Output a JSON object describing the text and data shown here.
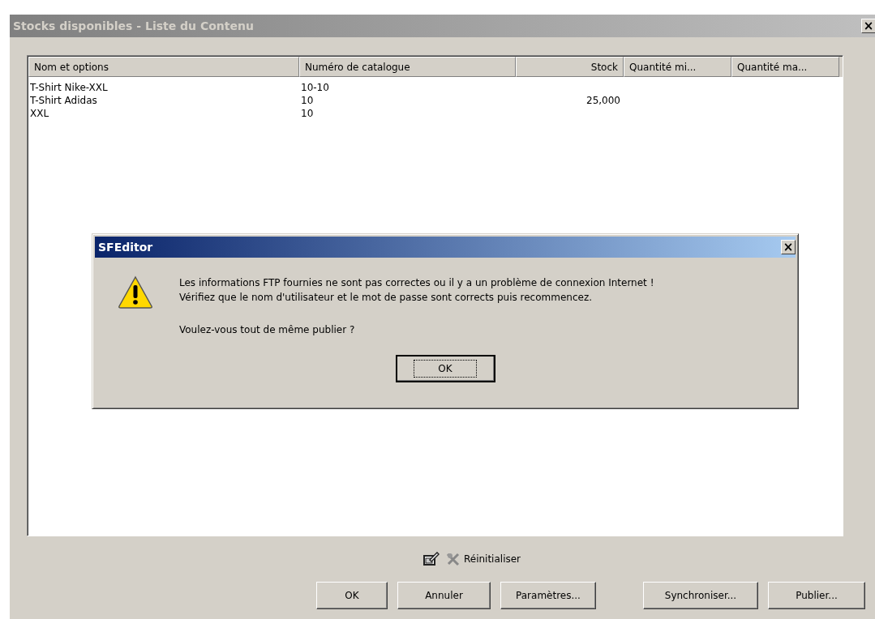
{
  "window": {
    "title": "Stocks disponibles - Liste du Contenu",
    "active": false,
    "close_label": "×"
  },
  "table": {
    "columns": [
      {
        "label": "Nom et options",
        "kind": "text"
      },
      {
        "label": "Numéro de catalogue",
        "kind": "text"
      },
      {
        "label": "Stock",
        "kind": "number"
      },
      {
        "label": "Quantité mi...",
        "kind": "text"
      },
      {
        "label": "Quantité ma...",
        "kind": "text"
      }
    ],
    "rows": [
      [
        "T-Shirt Nike-XXL",
        "10-10",
        "",
        "",
        ""
      ],
      [
        "T-Shirt Adidas",
        "10",
        "25,000",
        "",
        ""
      ],
      [
        "XXL",
        "10",
        "",
        "",
        ""
      ]
    ]
  },
  "toolbar": {
    "reset_label": "Réinitialiser"
  },
  "buttons": [
    {
      "label": "OK"
    },
    {
      "label": "Annuler"
    },
    {
      "label": "Paramètres..."
    },
    {
      "label": "Synchroniser..."
    },
    {
      "label": "Publier..."
    }
  ],
  "dialog": {
    "title": "SFEditor",
    "active": true,
    "close_label": "×",
    "message": [
      "Les informations FTP fournies ne sont pas correctes ou il y a un problème de connexion Internet !",
      "Vérifiez que le nom d'utilisateur et le mot de passe sont corrects puis recommencez."
    ],
    "question": "Voulez-vous tout de même publier ?",
    "button": {
      "label": "OK",
      "focused": true
    }
  }
}
